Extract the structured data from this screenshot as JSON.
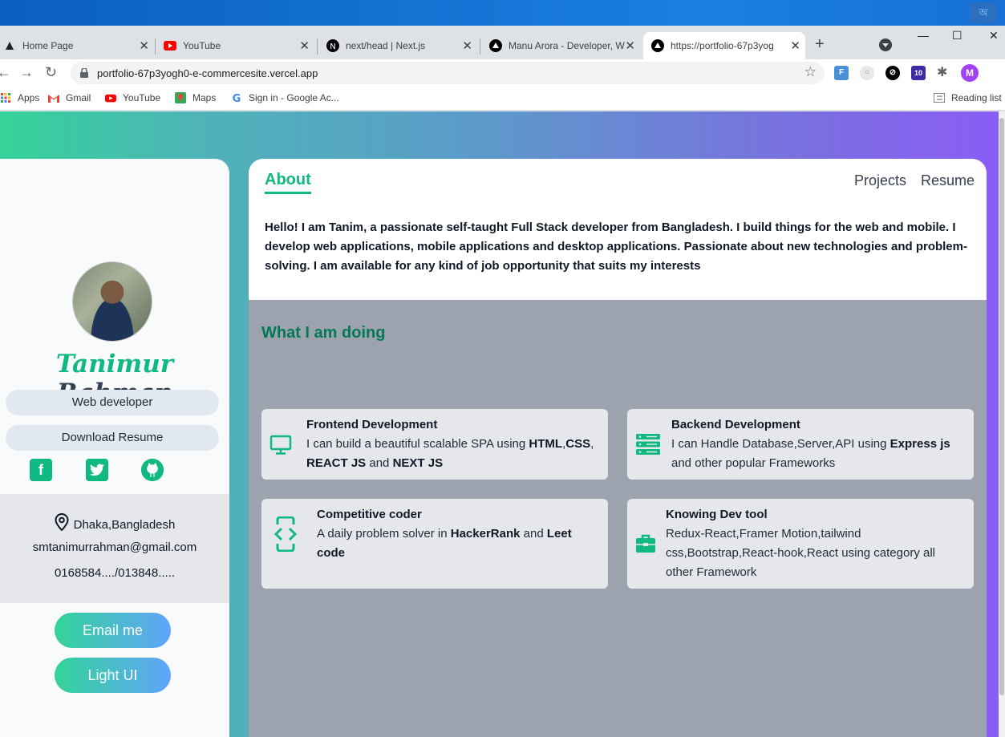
{
  "browser": {
    "tabs": [
      {
        "label": "Home Page"
      },
      {
        "label": "YouTube"
      },
      {
        "label": "next/head | Next.js"
      },
      {
        "label": "Manu Arora - Developer, W"
      },
      {
        "label": "https://portfolio-67p3yog"
      }
    ],
    "url": "portfolio-67p3yogh0-e-commercesite.vercel.app",
    "ext_badge": "10",
    "profile_initial": "M",
    "bookmarks": [
      {
        "label": "Apps"
      },
      {
        "label": "Gmail"
      },
      {
        "label": "YouTube"
      },
      {
        "label": "Maps"
      },
      {
        "label": "Sign in - Google Ac..."
      }
    ],
    "reading_list": "Reading list"
  },
  "profile": {
    "first_name": "Tanimur",
    "last_name": "Rahman",
    "role": "Web developer",
    "download_label": "Download Resume",
    "location": "Dhaka,Bangladesh",
    "email": "smtanimurrahman@gmail.com",
    "phone": "0168584..../013848.....",
    "email_button": "Email me",
    "theme_button": "Light UI"
  },
  "nav": {
    "about": "About",
    "projects": "Projects",
    "resume": "Resume"
  },
  "about": {
    "bio": "Hello! I am Tanim, a passionate self-taught Full Stack developer from Bangladesh. I build things for the web and mobile. I develop web applications, mobile applications and desktop applications. Passionate about new technologies and problem-solving. I am available for any kind of job opportunity that suits my interests"
  },
  "doing": {
    "title": "What I am doing",
    "services": [
      {
        "title": "Frontend Development",
        "desc_1": "I can build a beautiful scalable SPA using ",
        "b1": "HTML",
        "s1": ",",
        "b2": "CSS",
        "s2": ", ",
        "b3": "REACT JS",
        "s3": " and ",
        "b4": "NEXT JS"
      },
      {
        "title": "Backend Development",
        "desc_1": "I can Handle Database,Server,API using ",
        "b1": "Express js",
        "desc_2": " and other popular Frameworks"
      },
      {
        "title": "Competitive coder",
        "desc_1": "A daily problem solver in ",
        "b1": "HackerRank",
        "s1": " and ",
        "b2": "Leet code"
      },
      {
        "title": "Knowing Dev tool",
        "desc_1": "Redux-React,Framer Motion,tailwind css,Bootstrap,React-hook,React using category all other Framework"
      }
    ]
  },
  "colors": {
    "accent": "#10b981",
    "gradient_start": "#34d399",
    "gradient_end": "#8b5cf6"
  }
}
